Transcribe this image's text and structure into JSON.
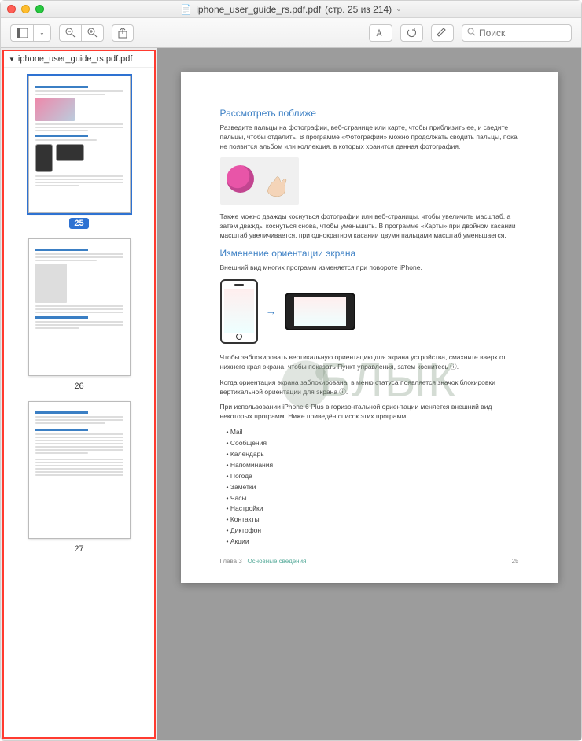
{
  "window": {
    "title_prefix": "iphone_user_guide_rs.pdf.pdf",
    "title_pages": "(стр. 25 из 214)",
    "file_icon": "📄"
  },
  "toolbar": {
    "search_placeholder": "Поиск"
  },
  "sidebar": {
    "filename": "iphone_user_guide_rs.pdf.pdf",
    "thumbs": [
      {
        "label": "25",
        "selected": true
      },
      {
        "label": "26",
        "selected": false
      },
      {
        "label": "27",
        "selected": false
      }
    ]
  },
  "document": {
    "section1_title": "Рассмотреть поближе",
    "section1_p1": "Разведите пальцы на фотографии, веб-странице или карте, чтобы приблизить ее, и сведите пальцы, чтобы отдалить. В программе «Фотографии» можно продолжать сводить пальцы, пока не появится альбом или коллекция, в которых хранится данная фотография.",
    "section1_p2": "Также можно дважды коснуться фотографии или веб-страницы, чтобы увеличить масштаб, а затем дважды коснуться снова, чтобы уменьшить. В программе «Карты» при двойном касании масштаб увеличивается, при однократном касании двумя пальцами масштаб уменьшается.",
    "section2_title": "Изменение ориентации экрана",
    "section2_p1": "Внешний вид многих программ изменяется при повороте iPhone.",
    "section2_p2": "Чтобы заблокировать вертикальную ориентацию для экрана устройства, смахните вверх от нижнего края экрана, чтобы показать Пункт управления, затем коснитесь ⓘ.",
    "section2_p3": "Когда ориентация экрана заблокирована, в меню статуса появляется значок блокировки вертикальной ориентации для экрана ⓘ.",
    "section2_p4": "При использовании iPhone 6 Plus в горизонтальной ориентации меняется внешний вид некоторых программ. Ниже приведён список этих программ.",
    "bullets": [
      "Mail",
      "Сообщения",
      "Календарь",
      "Напоминания",
      "Погода",
      "Заметки",
      "Часы",
      "Настройки",
      "Контакты",
      "Диктофон",
      "Акции"
    ],
    "footer_chapter": "Глава 3",
    "footer_section": "Основные сведения",
    "footer_page": "25"
  },
  "watermark": "БЛЫК"
}
